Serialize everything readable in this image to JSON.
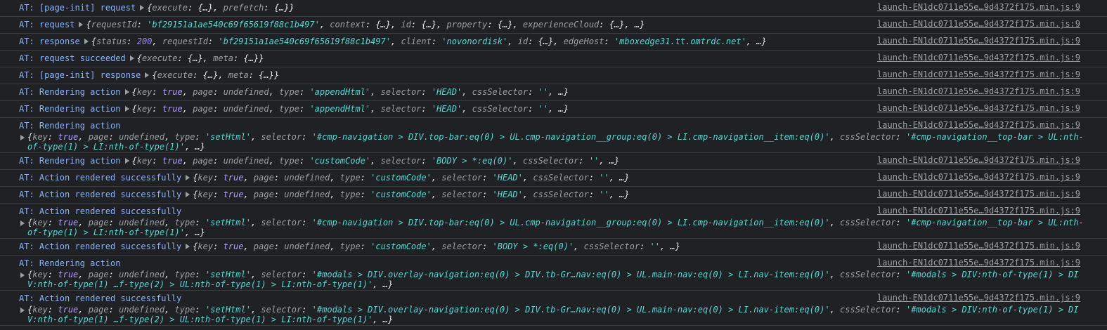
{
  "source_link": "launch-EN1dc0711e55e…9d4372f175.min.js:9",
  "rows": [
    {
      "label": "AT: [page-init] request",
      "layout": "single",
      "segments": [
        [
          "p",
          "{"
        ],
        [
          "k",
          "execute"
        ],
        [
          "p",
          ": "
        ],
        [
          "p",
          "{…}"
        ],
        [
          "p",
          ", "
        ],
        [
          "k",
          "prefetch"
        ],
        [
          "p",
          ": "
        ],
        [
          "p",
          "{…}"
        ],
        [
          "p",
          "}"
        ]
      ]
    },
    {
      "label": "AT: request",
      "layout": "single",
      "segments": [
        [
          "p",
          "{"
        ],
        [
          "k",
          "requestId"
        ],
        [
          "p",
          ": "
        ],
        [
          "s",
          "'bf29151a1ae540c69f65619f88c1b497'"
        ],
        [
          "p",
          ", "
        ],
        [
          "k",
          "context"
        ],
        [
          "p",
          ": "
        ],
        [
          "p",
          "{…}"
        ],
        [
          "p",
          ", "
        ],
        [
          "k",
          "id"
        ],
        [
          "p",
          ": "
        ],
        [
          "p",
          "{…}"
        ],
        [
          "p",
          ", "
        ],
        [
          "k",
          "property"
        ],
        [
          "p",
          ": "
        ],
        [
          "p",
          "{…}"
        ],
        [
          "p",
          ", "
        ],
        [
          "k",
          "experienceCloud"
        ],
        [
          "p",
          ": "
        ],
        [
          "p",
          "{…}"
        ],
        [
          "p",
          ", …}"
        ]
      ]
    },
    {
      "label": "AT: response",
      "layout": "single",
      "segments": [
        [
          "p",
          "{"
        ],
        [
          "k",
          "status"
        ],
        [
          "p",
          ": "
        ],
        [
          "n",
          "200"
        ],
        [
          "p",
          ", "
        ],
        [
          "k",
          "requestId"
        ],
        [
          "p",
          ": "
        ],
        [
          "s",
          "'bf29151a1ae540c69f65619f88c1b497'"
        ],
        [
          "p",
          ", "
        ],
        [
          "k",
          "client"
        ],
        [
          "p",
          ": "
        ],
        [
          "s",
          "'novonordisk'"
        ],
        [
          "p",
          ", "
        ],
        [
          "k",
          "id"
        ],
        [
          "p",
          ": "
        ],
        [
          "p",
          "{…}"
        ],
        [
          "p",
          ", "
        ],
        [
          "k",
          "edgeHost"
        ],
        [
          "p",
          ": "
        ],
        [
          "s",
          "'mboxedge31.tt.omtrdc.net'"
        ],
        [
          "p",
          ", …}"
        ]
      ]
    },
    {
      "label": "AT: request succeeded",
      "layout": "single",
      "segments": [
        [
          "p",
          "{"
        ],
        [
          "k",
          "execute"
        ],
        [
          "p",
          ": "
        ],
        [
          "p",
          "{…}"
        ],
        [
          "p",
          ", "
        ],
        [
          "k",
          "meta"
        ],
        [
          "p",
          ": "
        ],
        [
          "p",
          "{…}"
        ],
        [
          "p",
          "}"
        ]
      ]
    },
    {
      "label": "AT: [page-init] response",
      "layout": "single",
      "segments": [
        [
          "p",
          "{"
        ],
        [
          "k",
          "execute"
        ],
        [
          "p",
          ": "
        ],
        [
          "p",
          "{…}"
        ],
        [
          "p",
          ", "
        ],
        [
          "k",
          "meta"
        ],
        [
          "p",
          ": "
        ],
        [
          "p",
          "{…}"
        ],
        [
          "p",
          "}"
        ]
      ]
    },
    {
      "label": "AT: Rendering action",
      "layout": "single",
      "segments": [
        [
          "p",
          "{"
        ],
        [
          "k",
          "key"
        ],
        [
          "p",
          ": "
        ],
        [
          "b",
          "true"
        ],
        [
          "p",
          ", "
        ],
        [
          "k",
          "page"
        ],
        [
          "p",
          ": "
        ],
        [
          "u",
          "undefined"
        ],
        [
          "p",
          ", "
        ],
        [
          "k",
          "type"
        ],
        [
          "p",
          ": "
        ],
        [
          "s",
          "'appendHtml'"
        ],
        [
          "p",
          ", "
        ],
        [
          "k",
          "selector"
        ],
        [
          "p",
          ": "
        ],
        [
          "s",
          "'HEAD'"
        ],
        [
          "p",
          ", "
        ],
        [
          "k",
          "cssSelector"
        ],
        [
          "p",
          ": "
        ],
        [
          "s",
          "''"
        ],
        [
          "p",
          ", …}"
        ]
      ]
    },
    {
      "label": "AT: Rendering action",
      "layout": "single",
      "segments": [
        [
          "p",
          "{"
        ],
        [
          "k",
          "key"
        ],
        [
          "p",
          ": "
        ],
        [
          "b",
          "true"
        ],
        [
          "p",
          ", "
        ],
        [
          "k",
          "page"
        ],
        [
          "p",
          ": "
        ],
        [
          "u",
          "undefined"
        ],
        [
          "p",
          ", "
        ],
        [
          "k",
          "type"
        ],
        [
          "p",
          ": "
        ],
        [
          "s",
          "'appendHtml'"
        ],
        [
          "p",
          ", "
        ],
        [
          "k",
          "selector"
        ],
        [
          "p",
          ": "
        ],
        [
          "s",
          "'HEAD'"
        ],
        [
          "p",
          ", "
        ],
        [
          "k",
          "cssSelector"
        ],
        [
          "p",
          ": "
        ],
        [
          "s",
          "''"
        ],
        [
          "p",
          ", …}"
        ]
      ]
    },
    {
      "label": "AT: Rendering action",
      "layout": "d2",
      "segments": [
        [
          "p",
          "{"
        ],
        [
          "k",
          "key"
        ],
        [
          "p",
          ": "
        ],
        [
          "b",
          "true"
        ],
        [
          "p",
          ", "
        ],
        [
          "k",
          "page"
        ],
        [
          "p",
          ": "
        ],
        [
          "u",
          "undefined"
        ],
        [
          "p",
          ", "
        ],
        [
          "k",
          "type"
        ],
        [
          "p",
          ": "
        ],
        [
          "s",
          "'setHtml'"
        ],
        [
          "p",
          ", "
        ],
        [
          "k",
          "selector"
        ],
        [
          "p",
          ": "
        ],
        [
          "s",
          "'#cmp-navigation > DIV.top-bar:eq(0) > UL.cmp-navigation__group:eq(0) > LI.cmp-navigation__item:eq(0)'"
        ],
        [
          "p",
          ", "
        ],
        [
          "k",
          "cssSelector"
        ],
        [
          "p",
          ": "
        ],
        [
          "s",
          "'#cmp-navigation__top-bar > UL:nth-of-type(1) > LI:nth-of-type(1)'"
        ],
        [
          "p",
          ", …}"
        ]
      ]
    },
    {
      "label": "AT: Rendering action",
      "layout": "single",
      "segments": [
        [
          "p",
          "{"
        ],
        [
          "k",
          "key"
        ],
        [
          "p",
          ": "
        ],
        [
          "b",
          "true"
        ],
        [
          "p",
          ", "
        ],
        [
          "k",
          "page"
        ],
        [
          "p",
          ": "
        ],
        [
          "u",
          "undefined"
        ],
        [
          "p",
          ", "
        ],
        [
          "k",
          "type"
        ],
        [
          "p",
          ": "
        ],
        [
          "s",
          "'customCode'"
        ],
        [
          "p",
          ", "
        ],
        [
          "k",
          "selector"
        ],
        [
          "p",
          ": "
        ],
        [
          "s",
          "'BODY > *:eq(0)'"
        ],
        [
          "p",
          ", "
        ],
        [
          "k",
          "cssSelector"
        ],
        [
          "p",
          ": "
        ],
        [
          "s",
          "''"
        ],
        [
          "p",
          ", …}"
        ]
      ]
    },
    {
      "label": "AT: Action rendered successfully",
      "layout": "single",
      "segments": [
        [
          "p",
          "{"
        ],
        [
          "k",
          "key"
        ],
        [
          "p",
          ": "
        ],
        [
          "b",
          "true"
        ],
        [
          "p",
          ", "
        ],
        [
          "k",
          "page"
        ],
        [
          "p",
          ": "
        ],
        [
          "u",
          "undefined"
        ],
        [
          "p",
          ", "
        ],
        [
          "k",
          "type"
        ],
        [
          "p",
          ": "
        ],
        [
          "s",
          "'customCode'"
        ],
        [
          "p",
          ", "
        ],
        [
          "k",
          "selector"
        ],
        [
          "p",
          ": "
        ],
        [
          "s",
          "'HEAD'"
        ],
        [
          "p",
          ", "
        ],
        [
          "k",
          "cssSelector"
        ],
        [
          "p",
          ": "
        ],
        [
          "s",
          "''"
        ],
        [
          "p",
          ", …}"
        ]
      ]
    },
    {
      "label": "AT: Action rendered successfully",
      "layout": "single",
      "segments": [
        [
          "p",
          "{"
        ],
        [
          "k",
          "key"
        ],
        [
          "p",
          ": "
        ],
        [
          "b",
          "true"
        ],
        [
          "p",
          ", "
        ],
        [
          "k",
          "page"
        ],
        [
          "p",
          ": "
        ],
        [
          "u",
          "undefined"
        ],
        [
          "p",
          ", "
        ],
        [
          "k",
          "type"
        ],
        [
          "p",
          ": "
        ],
        [
          "s",
          "'customCode'"
        ],
        [
          "p",
          ", "
        ],
        [
          "k",
          "selector"
        ],
        [
          "p",
          ": "
        ],
        [
          "s",
          "'HEAD'"
        ],
        [
          "p",
          ", "
        ],
        [
          "k",
          "cssSelector"
        ],
        [
          "p",
          ": "
        ],
        [
          "s",
          "''"
        ],
        [
          "p",
          ", …}"
        ]
      ]
    },
    {
      "label": "AT: Action rendered successfully",
      "layout": "d2",
      "segments": [
        [
          "p",
          "{"
        ],
        [
          "k",
          "key"
        ],
        [
          "p",
          ": "
        ],
        [
          "b",
          "true"
        ],
        [
          "p",
          ", "
        ],
        [
          "k",
          "page"
        ],
        [
          "p",
          ": "
        ],
        [
          "u",
          "undefined"
        ],
        [
          "p",
          ", "
        ],
        [
          "k",
          "type"
        ],
        [
          "p",
          ": "
        ],
        [
          "s",
          "'setHtml'"
        ],
        [
          "p",
          ", "
        ],
        [
          "k",
          "selector"
        ],
        [
          "p",
          ": "
        ],
        [
          "s",
          "'#cmp-navigation > DIV.top-bar:eq(0) > UL.cmp-navigation__group:eq(0) > LI.cmp-navigation__item:eq(0)'"
        ],
        [
          "p",
          ", "
        ],
        [
          "k",
          "cssSelector"
        ],
        [
          "p",
          ": "
        ],
        [
          "s",
          "'#cmp-navigation__top-bar > UL:nth-of-type(1) > LI:nth-of-type(1)'"
        ],
        [
          "p",
          ", …}"
        ]
      ]
    },
    {
      "label": "AT: Action rendered successfully",
      "layout": "single",
      "segments": [
        [
          "p",
          "{"
        ],
        [
          "k",
          "key"
        ],
        [
          "p",
          ": "
        ],
        [
          "b",
          "true"
        ],
        [
          "p",
          ", "
        ],
        [
          "k",
          "page"
        ],
        [
          "p",
          ": "
        ],
        [
          "u",
          "undefined"
        ],
        [
          "p",
          ", "
        ],
        [
          "k",
          "type"
        ],
        [
          "p",
          ": "
        ],
        [
          "s",
          "'customCode'"
        ],
        [
          "p",
          ", "
        ],
        [
          "k",
          "selector"
        ],
        [
          "p",
          ": "
        ],
        [
          "s",
          "'BODY > *:eq(0)'"
        ],
        [
          "p",
          ", "
        ],
        [
          "k",
          "cssSelector"
        ],
        [
          "p",
          ": "
        ],
        [
          "s",
          "''"
        ],
        [
          "p",
          ", …}"
        ]
      ]
    },
    {
      "label": "AT: Rendering action",
      "layout": "d3",
      "segments": [
        [
          "p",
          "{"
        ],
        [
          "k",
          "key"
        ],
        [
          "p",
          ": "
        ],
        [
          "b",
          "true"
        ],
        [
          "p",
          ", "
        ],
        [
          "k",
          "page"
        ],
        [
          "p",
          ": "
        ],
        [
          "u",
          "undefined"
        ],
        [
          "p",
          ", "
        ],
        [
          "k",
          "type"
        ],
        [
          "p",
          ": "
        ],
        [
          "s",
          "'setHtml'"
        ],
        [
          "p",
          ", "
        ],
        [
          "k",
          "selector"
        ],
        [
          "p",
          ": "
        ],
        [
          "s",
          "'#modals > DIV.overlay-navigation:eq(0) > DIV.tb-Gr…nav:eq(0) > UL.main-nav:eq(0) > LI.nav-item:eq(0)'"
        ],
        [
          "p",
          ", "
        ],
        [
          "k",
          "cssSelector"
        ],
        [
          "p",
          ": "
        ],
        [
          "s",
          "'#modals > DIV:nth-of-type(1) > DIV:nth-of-type(1) …f-type(2) > UL:nth-of-type(1) > LI:nth-of-type(1)'"
        ],
        [
          "p",
          ", …}"
        ]
      ]
    },
    {
      "label": "AT: Action rendered successfully",
      "layout": "d3",
      "segments": [
        [
          "p",
          "{"
        ],
        [
          "k",
          "key"
        ],
        [
          "p",
          ": "
        ],
        [
          "b",
          "true"
        ],
        [
          "p",
          ", "
        ],
        [
          "k",
          "page"
        ],
        [
          "p",
          ": "
        ],
        [
          "u",
          "undefined"
        ],
        [
          "p",
          ", "
        ],
        [
          "k",
          "type"
        ],
        [
          "p",
          ": "
        ],
        [
          "s",
          "'setHtml'"
        ],
        [
          "p",
          ", "
        ],
        [
          "k",
          "selector"
        ],
        [
          "p",
          ": "
        ],
        [
          "s",
          "'#modals > DIV.overlay-navigation:eq(0) > DIV.tb-Gr…nav:eq(0) > UL.main-nav:eq(0) > LI.nav-item:eq(0)'"
        ],
        [
          "p",
          ", "
        ],
        [
          "k",
          "cssSelector"
        ],
        [
          "p",
          ": "
        ],
        [
          "s",
          "'#modals > DIV:nth-of-type(1) > DIV:nth-of-type(1) …f-type(2) > UL:nth-of-type(1) > LI:nth-of-type(1)'"
        ],
        [
          "p",
          ", …}"
        ]
      ]
    }
  ]
}
